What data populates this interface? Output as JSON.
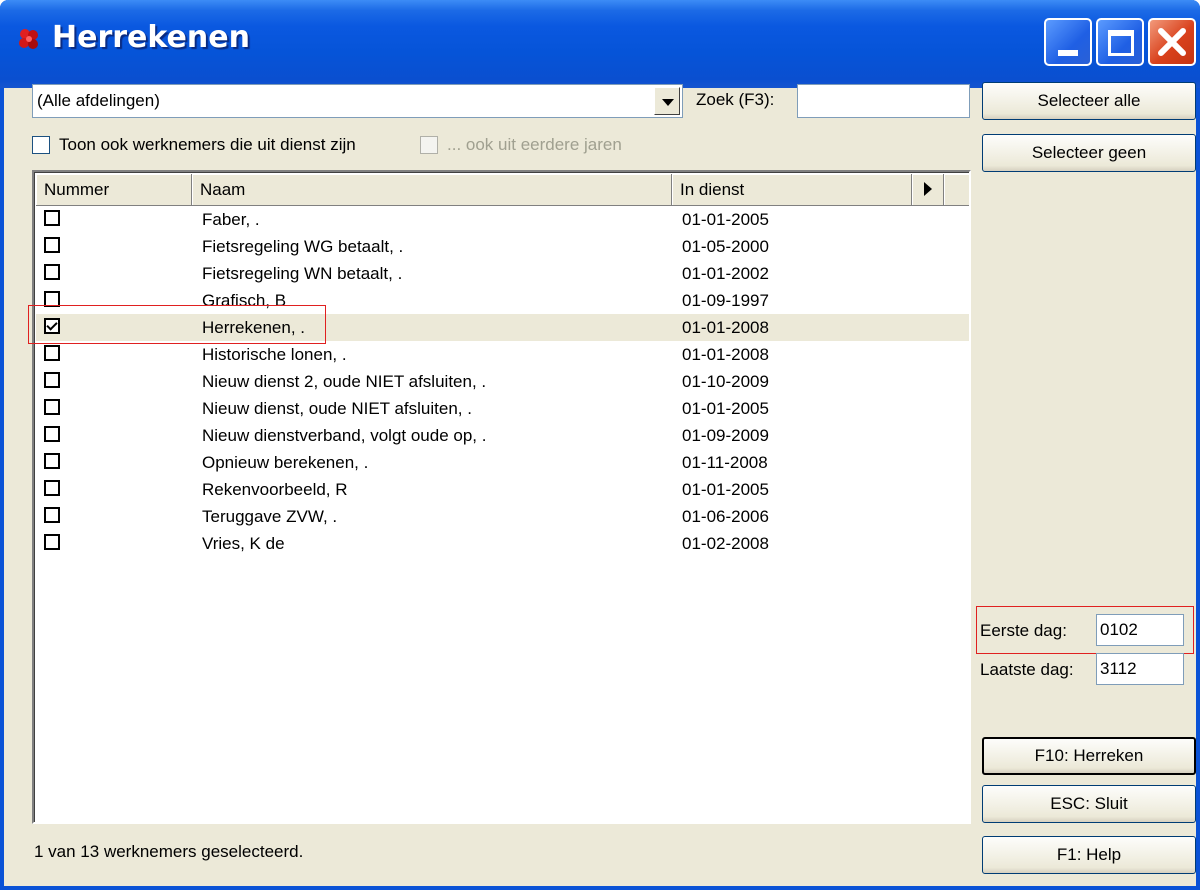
{
  "window": {
    "title": "Herrekenen",
    "accent": "#0a52d6",
    "close_color": "#d9411c"
  },
  "filters": {
    "department": "(Alle afdelingen)",
    "search_label": "Zoek (F3):",
    "search_value": "",
    "show_inactive_label": "Toon ook werknemers die uit dienst zijn",
    "show_inactive_checked": false,
    "earlier_years_label": "... ook uit eerdere jaren",
    "earlier_years_enabled": false
  },
  "buttons": {
    "select_all": "Selecteer alle",
    "select_none": "Selecteer geen",
    "recalc": "F10: Herreken",
    "close": "ESC: Sluit",
    "help": "F1: Help"
  },
  "grid": {
    "columns": [
      "Nummer",
      "Naam",
      "In dienst"
    ],
    "rows": [
      {
        "checked": false,
        "name": "Faber, .",
        "in_dienst": "01-01-2005"
      },
      {
        "checked": false,
        "name": "Fietsregeling WG betaalt, .",
        "in_dienst": "01-05-2000"
      },
      {
        "checked": false,
        "name": "Fietsregeling WN betaalt, .",
        "in_dienst": "01-01-2002"
      },
      {
        "checked": false,
        "name": "Grafisch, B",
        "in_dienst": "01-09-1997"
      },
      {
        "checked": true,
        "name": "Herrekenen, .",
        "in_dienst": "01-01-2008"
      },
      {
        "checked": false,
        "name": "Historische lonen, .",
        "in_dienst": "01-01-2008"
      },
      {
        "checked": false,
        "name": "Nieuw dienst 2, oude NIET afsluiten, .",
        "in_dienst": "01-10-2009"
      },
      {
        "checked": false,
        "name": "Nieuw dienst, oude NIET afsluiten, .",
        "in_dienst": "01-01-2005"
      },
      {
        "checked": false,
        "name": "Nieuw dienstverband, volgt oude op, .",
        "in_dienst": "01-09-2009"
      },
      {
        "checked": false,
        "name": "Opnieuw berekenen, .",
        "in_dienst": "01-11-2008"
      },
      {
        "checked": false,
        "name": "Rekenvoorbeeld, R",
        "in_dienst": "01-01-2005"
      },
      {
        "checked": false,
        "name": "Teruggave ZVW, .",
        "in_dienst": "01-06-2006"
      },
      {
        "checked": false,
        "name": "Vries, K de",
        "in_dienst": "01-02-2008"
      }
    ]
  },
  "period": {
    "first_label": "Eerste dag:",
    "first_value": "0102",
    "last_label": "Laatste dag:",
    "last_value": "3112"
  },
  "status": "1 van 13 werknemers geselecteerd."
}
